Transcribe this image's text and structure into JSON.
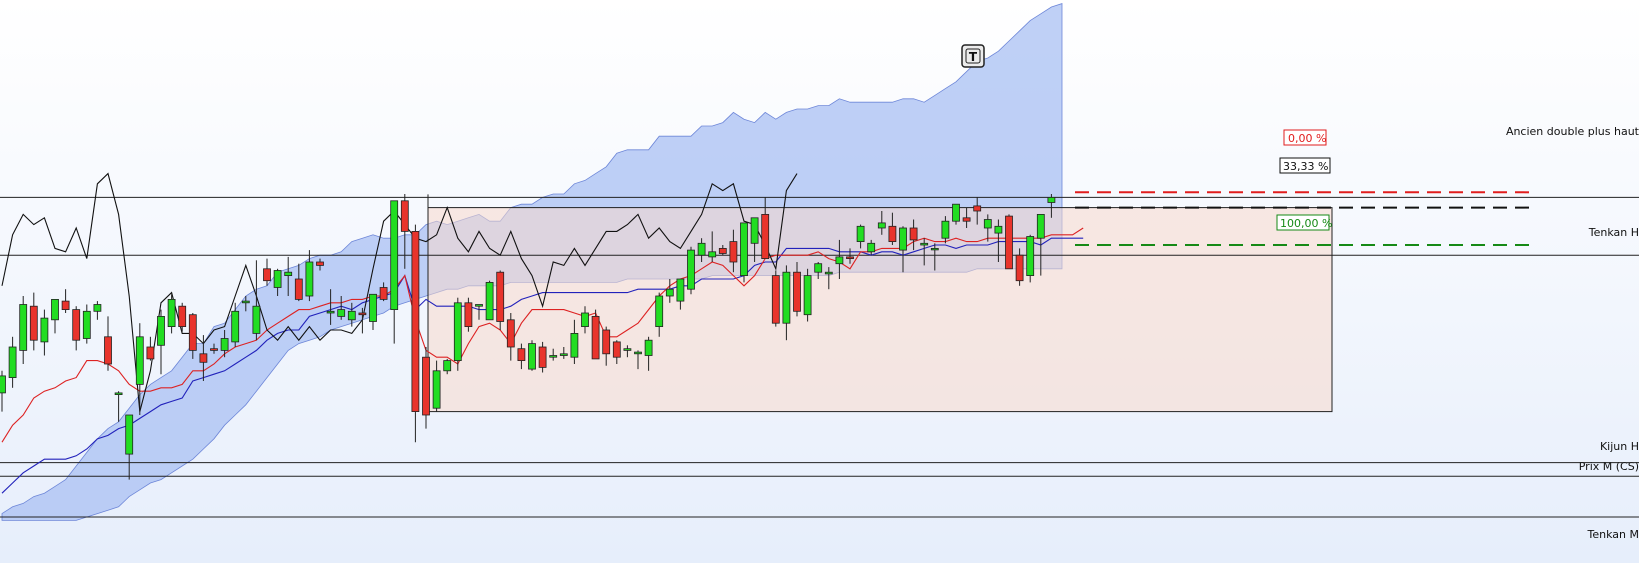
{
  "chart_data": {
    "type": "candlestick",
    "x": [],
    "ylim": [
      0,
      100
    ],
    "grid": false,
    "colors": {
      "bull": "#22dd22",
      "bear": "#e8342c",
      "tenkan": "#dd2222",
      "kijun": "#2222bb",
      "chikou": "#111111",
      "cloud": "#a9c0f3",
      "range_box": "#f7d9cc"
    },
    "toolbar": {
      "text_tool": "T",
      "icon": "text-tool-icon"
    },
    "candles": [
      {
        "o": 31.5,
        "h": 38.0,
        "l": 26.0,
        "c": 36.5
      },
      {
        "o": 36.0,
        "h": 48.0,
        "l": 33.0,
        "c": 45.0
      },
      {
        "o": 44.0,
        "h": 60.0,
        "l": 40.0,
        "c": 57.5
      },
      {
        "o": 57.0,
        "h": 61.0,
        "l": 44.0,
        "c": 47.0
      },
      {
        "o": 46.5,
        "h": 56.0,
        "l": 42.5,
        "c": 53.5
      },
      {
        "o": 53.0,
        "h": 59.0,
        "l": 49.0,
        "c": 59.0
      },
      {
        "o": 58.5,
        "h": 62.0,
        "l": 55.0,
        "c": 56.0
      },
      {
        "o": 56.0,
        "h": 57.0,
        "l": 44.0,
        "c": 47.0
      },
      {
        "o": 47.5,
        "h": 57.5,
        "l": 46.0,
        "c": 55.5
      },
      {
        "o": 55.5,
        "h": 58.5,
        "l": 53.0,
        "c": 57.5
      },
      {
        "o": 48.0,
        "h": 54.0,
        "l": 38.0,
        "c": 40.0
      },
      {
        "o": 31.0,
        "h": 32.0,
        "l": 23.0,
        "c": 31.5
      },
      {
        "o": 13.5,
        "h": 25.0,
        "l": 6.0,
        "c": 25.0
      },
      {
        "o": 34.0,
        "h": 52.0,
        "l": 25.0,
        "c": 48.0
      },
      {
        "o": 45.0,
        "h": 48.0,
        "l": 41.0,
        "c": 41.5
      },
      {
        "o": 45.5,
        "h": 56.0,
        "l": 37.0,
        "c": 54.0
      },
      {
        "o": 51.0,
        "h": 60.5,
        "l": 49.0,
        "c": 59.0
      },
      {
        "o": 57.0,
        "h": 58.0,
        "l": 49.5,
        "c": 51.0
      },
      {
        "o": 54.5,
        "h": 55.0,
        "l": 41.5,
        "c": 44.0
      },
      {
        "o": 43.0,
        "h": 48.5,
        "l": 35.0,
        "c": 40.5
      },
      {
        "o": 44.5,
        "h": 46.0,
        "l": 43.0,
        "c": 44.0
      },
      {
        "o": 44.0,
        "h": 50.0,
        "l": 42.0,
        "c": 47.5
      },
      {
        "o": 46.5,
        "h": 58.0,
        "l": 45.0,
        "c": 55.5
      },
      {
        "o": 58.0,
        "h": 60.0,
        "l": 55.5,
        "c": 58.5
      },
      {
        "o": 49.0,
        "h": 70.5,
        "l": 47.0,
        "c": 57.0
      },
      {
        "o": 68.0,
        "h": 71.0,
        "l": 63.0,
        "c": 64.5
      },
      {
        "o": 62.5,
        "h": 68.0,
        "l": 60.0,
        "c": 67.5
      },
      {
        "o": 66.0,
        "h": 71.5,
        "l": 60.0,
        "c": 67.0
      },
      {
        "o": 65.0,
        "h": 69.5,
        "l": 58.5,
        "c": 59.0
      },
      {
        "o": 60.0,
        "h": 73.5,
        "l": 58.5,
        "c": 70.0
      },
      {
        "o": 70.0,
        "h": 71.0,
        "l": 67.5,
        "c": 69.0
      },
      {
        "o": 55.0,
        "h": 62.0,
        "l": 51.5,
        "c": 55.5
      },
      {
        "o": 54.0,
        "h": 60.0,
        "l": 53.0,
        "c": 56.0
      },
      {
        "o": 53.0,
        "h": 58.0,
        "l": 51.0,
        "c": 55.5
      },
      {
        "o": 55.0,
        "h": 56.5,
        "l": 49.0,
        "c": 54.5
      },
      {
        "o": 52.5,
        "h": 60.0,
        "l": 50.0,
        "c": 60.5
      },
      {
        "o": 62.5,
        "h": 64.0,
        "l": 58.5,
        "c": 59.0
      },
      {
        "o": 56.0,
        "h": 65.0,
        "l": 46.0,
        "c": 88.0
      },
      {
        "o": 88.0,
        "h": 90.0,
        "l": 68.0,
        "c": 79.0
      },
      {
        "o": 79.0,
        "h": 81.0,
        "l": 17.0,
        "c": 26.0
      },
      {
        "o": 42.0,
        "h": 45.0,
        "l": 21.0,
        "c": 25.0
      },
      {
        "o": 27.0,
        "h": 41.0,
        "l": 26.0,
        "c": 38.0
      },
      {
        "o": 38.0,
        "h": 41.5,
        "l": 37.0,
        "c": 41.0
      },
      {
        "o": 41.0,
        "h": 59.5,
        "l": 38.0,
        "c": 58.0
      },
      {
        "o": 58.0,
        "h": 59.5,
        "l": 49.5,
        "c": 51.0
      },
      {
        "o": 57.0,
        "h": 57.5,
        "l": 53.0,
        "c": 57.5
      },
      {
        "o": 53.0,
        "h": 64.5,
        "l": 53.0,
        "c": 64.0
      },
      {
        "o": 67.0,
        "h": 67.5,
        "l": 50.0,
        "c": 52.5
      },
      {
        "o": 53.0,
        "h": 55.0,
        "l": 41.0,
        "c": 45.0
      },
      {
        "o": 44.5,
        "h": 46.0,
        "l": 38.5,
        "c": 41.0
      },
      {
        "o": 38.5,
        "h": 47.0,
        "l": 38.0,
        "c": 46.0
      },
      {
        "o": 45.0,
        "h": 46.5,
        "l": 37.5,
        "c": 39.0
      },
      {
        "o": 42.0,
        "h": 44.5,
        "l": 41.0,
        "c": 42.5
      },
      {
        "o": 42.5,
        "h": 45.0,
        "l": 41.5,
        "c": 43.0
      },
      {
        "o": 42.0,
        "h": 53.0,
        "l": 40.0,
        "c": 49.0
      },
      {
        "o": 51.0,
        "h": 57.0,
        "l": 49.0,
        "c": 55.0
      },
      {
        "o": 54.0,
        "h": 56.0,
        "l": 47.0,
        "c": 41.5
      },
      {
        "o": 50.0,
        "h": 51.0,
        "l": 39.5,
        "c": 43.0
      },
      {
        "o": 46.5,
        "h": 47.0,
        "l": 40.0,
        "c": 42.0
      },
      {
        "o": 44.0,
        "h": 45.5,
        "l": 42.0,
        "c": 44.5
      },
      {
        "o": 43.0,
        "h": 44.0,
        "l": 38.5,
        "c": 43.5
      },
      {
        "o": 42.5,
        "h": 48.0,
        "l": 38.0,
        "c": 47.0
      },
      {
        "o": 51.0,
        "h": 61.0,
        "l": 48.0,
        "c": 60.0
      },
      {
        "o": 60.0,
        "h": 65.0,
        "l": 58.0,
        "c": 62.0
      },
      {
        "o": 58.5,
        "h": 64.0,
        "l": 56.0,
        "c": 65.0
      },
      {
        "o": 62.0,
        "h": 74.5,
        "l": 60.5,
        "c": 73.5
      },
      {
        "o": 72.0,
        "h": 77.0,
        "l": 70.0,
        "c": 75.5
      },
      {
        "o": 71.5,
        "h": 79.0,
        "l": 70.0,
        "c": 73.0
      },
      {
        "o": 74.0,
        "h": 75.0,
        "l": 72.0,
        "c": 72.5
      },
      {
        "o": 76.0,
        "h": 79.5,
        "l": 67.0,
        "c": 70.0
      },
      {
        "o": 66.0,
        "h": 81.5,
        "l": 64.0,
        "c": 81.5
      },
      {
        "o": 75.5,
        "h": 82.5,
        "l": 70.0,
        "c": 83.0
      },
      {
        "o": 84.0,
        "h": 89.0,
        "l": 72.0,
        "c": 71.0
      },
      {
        "o": 66.0,
        "h": 67.5,
        "l": 51.0,
        "c": 52.0
      },
      {
        "o": 52.0,
        "h": 69.0,
        "l": 47.0,
        "c": 67.0
      },
      {
        "o": 67.0,
        "h": 70.0,
        "l": 54.0,
        "c": 55.5
      },
      {
        "o": 54.5,
        "h": 68.0,
        "l": 52.5,
        "c": 66.0
      },
      {
        "o": 67.0,
        "h": 70.0,
        "l": 65.0,
        "c": 69.5
      },
      {
        "o": 66.5,
        "h": 68.5,
        "l": 62.0,
        "c": 67.0
      },
      {
        "o": 69.5,
        "h": 76.5,
        "l": 65.0,
        "c": 71.5
      },
      {
        "o": 71.5,
        "h": 74.0,
        "l": 69.5,
        "c": 71.0
      },
      {
        "o": 76.0,
        "h": 81.0,
        "l": 74.0,
        "c": 80.5
      },
      {
        "o": 73.0,
        "h": 76.5,
        "l": 72.0,
        "c": 75.5
      },
      {
        "o": 80.0,
        "h": 85.0,
        "l": 78.0,
        "c": 81.5
      },
      {
        "o": 80.5,
        "h": 84.5,
        "l": 75.0,
        "c": 76.0
      },
      {
        "o": 73.5,
        "h": 80.5,
        "l": 67.0,
        "c": 80.0
      },
      {
        "o": 80.0,
        "h": 82.5,
        "l": 73.5,
        "c": 76.5
      },
      {
        "o": 75.0,
        "h": 77.0,
        "l": 69.0,
        "c": 75.5
      },
      {
        "o": 74.0,
        "h": 75.5,
        "l": 67.5,
        "c": 74.0
      },
      {
        "o": 77.0,
        "h": 83.5,
        "l": 75.5,
        "c": 82.0
      },
      {
        "o": 82.0,
        "h": 87.0,
        "l": 81.0,
        "c": 87.0
      },
      {
        "o": 83.0,
        "h": 86.0,
        "l": 80.0,
        "c": 82.0
      },
      {
        "o": 86.5,
        "h": 89.0,
        "l": 81.0,
        "c": 85.0
      },
      {
        "o": 80.0,
        "h": 84.0,
        "l": 76.0,
        "c": 82.5
      },
      {
        "o": 78.5,
        "h": 82.5,
        "l": 70.0,
        "c": 80.5
      },
      {
        "o": 83.5,
        "h": 84.0,
        "l": 68.0,
        "c": 68.0
      },
      {
        "o": 72.0,
        "h": 74.0,
        "l": 63.0,
        "c": 64.5
      },
      {
        "o": 66.0,
        "h": 78.0,
        "l": 64.0,
        "c": 77.5
      },
      {
        "o": 77.0,
        "h": 80.0,
        "l": 66.0,
        "c": 84.0
      },
      {
        "o": 87.5,
        "h": 90.0,
        "l": 83.0,
        "c": 89.0
      }
    ],
    "tenkan": [
      17,
      22,
      25,
      30,
      32,
      33,
      35,
      36,
      41,
      41,
      40,
      38,
      34,
      32,
      32,
      33,
      33,
      34,
      38,
      38,
      40,
      43,
      45,
      46,
      47,
      50,
      52,
      54,
      56,
      56,
      57,
      58,
      58,
      59,
      59,
      60,
      60,
      62,
      66,
      53,
      44,
      42,
      42,
      40,
      46,
      51,
      52,
      50,
      46,
      52,
      56,
      56,
      56,
      56,
      55,
      54,
      55,
      48,
      48,
      50,
      52,
      56,
      60,
      63,
      65,
      66,
      68,
      70,
      69,
      66,
      63,
      66,
      71,
      72,
      72,
      72,
      72,
      73,
      71,
      70,
      68,
      73,
      73,
      74,
      74,
      74,
      76,
      77,
      76,
      76,
      77,
      76,
      76,
      77,
      77,
      77,
      77,
      77,
      77,
      78,
      78,
      78,
      80
    ],
    "kijun": [
      2,
      5,
      8,
      10,
      12,
      12,
      12,
      13,
      15,
      18,
      19,
      21,
      22,
      24,
      26,
      28,
      29,
      30,
      35,
      36,
      37,
      38,
      40,
      42,
      44,
      47,
      49,
      50,
      50,
      54,
      55,
      56,
      57,
      56,
      58,
      59,
      60,
      61,
      66,
      56,
      59,
      57,
      57,
      57,
      57,
      56,
      56,
      56,
      57,
      59,
      60,
      61,
      61,
      61,
      61,
      61,
      61,
      61,
      61,
      61,
      62,
      62,
      62,
      62,
      63,
      63,
      65,
      65,
      65,
      65,
      66,
      69,
      70,
      70,
      74,
      74,
      74,
      74,
      74,
      73,
      73,
      73,
      72,
      73,
      73,
      72,
      73,
      74,
      75,
      75,
      74,
      75,
      75,
      75,
      76,
      76,
      76,
      76,
      75,
      77,
      77,
      77,
      77
    ],
    "chikou": [
      63,
      78,
      84,
      81,
      83,
      74,
      73,
      80,
      71,
      93,
      96,
      84,
      60,
      26,
      38,
      58,
      61,
      49,
      49,
      46,
      50,
      51,
      60,
      69,
      60,
      50,
      47,
      51,
      47,
      51,
      47,
      50,
      50,
      49,
      53,
      68,
      82,
      85,
      81,
      77,
      76,
      78,
      86,
      77,
      73,
      79,
      74,
      72,
      79,
      71,
      66,
      57,
      70,
      69,
      74,
      69,
      74,
      79,
      79,
      81,
      84,
      77,
      80,
      76,
      74,
      79,
      84,
      93,
      91,
      93,
      82,
      81,
      75,
      68,
      91,
      96
    ],
    "cloud_top": [
      -4,
      -2,
      -1,
      1,
      2,
      4,
      6,
      10,
      14,
      18,
      21,
      23,
      27,
      31,
      34,
      36,
      38,
      42,
      46,
      46,
      51,
      52,
      56,
      60,
      62,
      63,
      67,
      68,
      69,
      71,
      72,
      72,
      73,
      76,
      77,
      78,
      77,
      77,
      78,
      78,
      81,
      82,
      81,
      82,
      83,
      84,
      82,
      82,
      86,
      87,
      87,
      89,
      90,
      90,
      93,
      94,
      96,
      98,
      102,
      103,
      103,
      103,
      107,
      107,
      107,
      107,
      110,
      110,
      111,
      114,
      112,
      111,
      114,
      112,
      114,
      115,
      115,
      116,
      116,
      118,
      117,
      117,
      117,
      117,
      117,
      118,
      118,
      117,
      119,
      121,
      123,
      126,
      129,
      130,
      132,
      135,
      138,
      141,
      143,
      145,
      146
    ],
    "cloud_bot": [
      -6,
      -6,
      -6,
      -6,
      -6,
      -6,
      -6,
      -6,
      -5,
      -4,
      -3,
      -2,
      1,
      3,
      5,
      6,
      8,
      10,
      12,
      15,
      18,
      22,
      25,
      28,
      32,
      36,
      40,
      44,
      46,
      47,
      48,
      50,
      51,
      52,
      53,
      54,
      55,
      57,
      58,
      59,
      60,
      61,
      62,
      62,
      63,
      63,
      63,
      63,
      64,
      64,
      64,
      64,
      64,
      64,
      64,
      64,
      64,
      64,
      64,
      65,
      65,
      65,
      65,
      65,
      65,
      65,
      65,
      66,
      66,
      66,
      66,
      66,
      66,
      66,
      66,
      66,
      66,
      66,
      66,
      67,
      67,
      67,
      67,
      67,
      67,
      67,
      67,
      67,
      67,
      67,
      67,
      67,
      68,
      68,
      68,
      68,
      68,
      68,
      68,
      68,
      68,
      68
    ],
    "levels": [
      {
        "label": "Ancien double plus haut",
        "value": 89
      },
      {
        "label": "Tenkan H",
        "value": 72
      },
      {
        "label": "Kijun H",
        "value": 11
      },
      {
        "label": "Prix M (CS)",
        "value": 7
      },
      {
        "label": "Tenkan M",
        "value": -5
      }
    ],
    "range_box": {
      "top": 86,
      "bottom": 26
    },
    "retracements": [
      {
        "label": "0,00 %",
        "value": 90.5,
        "color": "#e11d1d"
      },
      {
        "label": "33,33 %",
        "value": 86,
        "color": "#111111"
      },
      {
        "label": "100,00 %",
        "value": 75,
        "color": "#168a16"
      }
    ]
  }
}
